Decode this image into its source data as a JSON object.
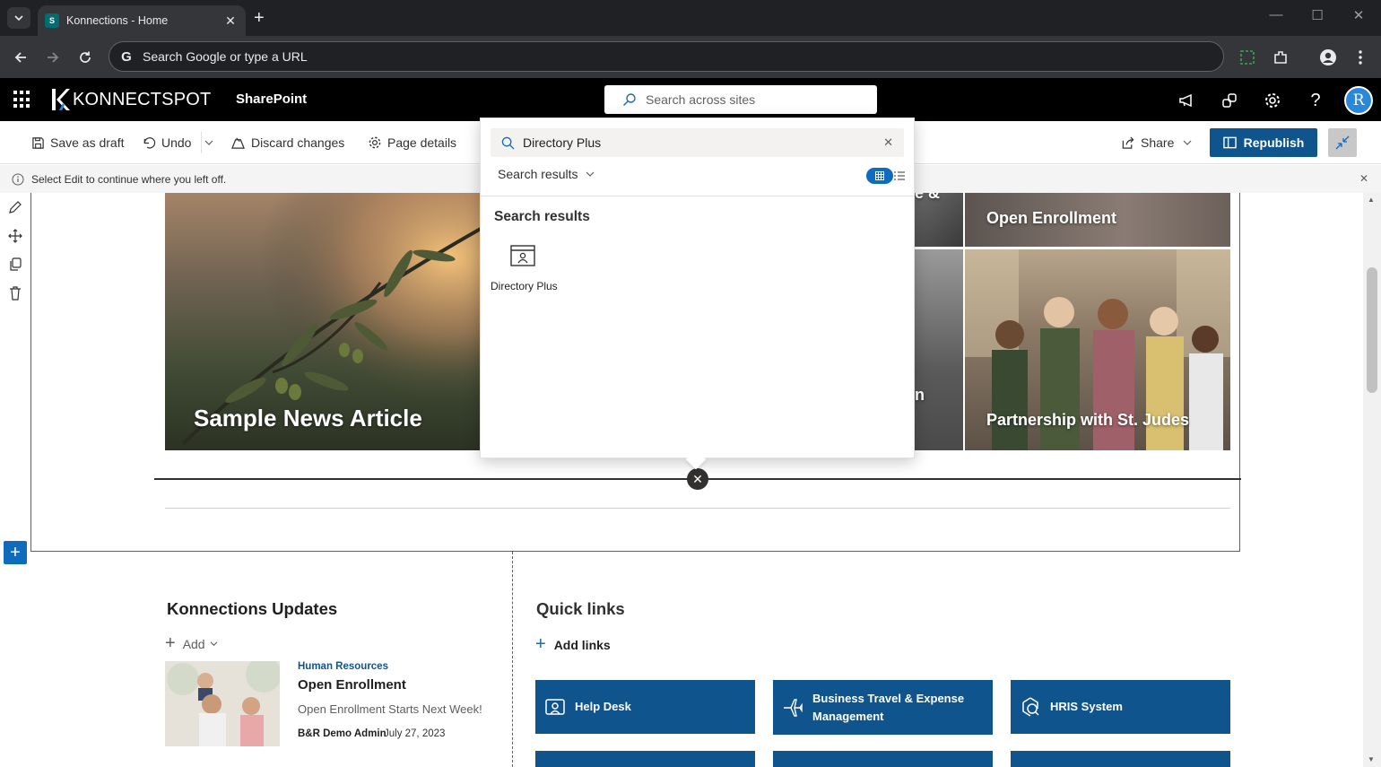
{
  "browser": {
    "tab_title": "Konnections - Home",
    "tab_favicon": "S",
    "omnibox_placeholder": "Search Google or type a URL"
  },
  "suite": {
    "brand": "KONNECTSPOT",
    "app_name": "SharePoint",
    "search_placeholder": "Search across sites",
    "avatar_initial": "R"
  },
  "commands": {
    "save_draft": "Save as draft",
    "undo": "Undo",
    "discard": "Discard changes",
    "page_details": "Page details",
    "share": "Share",
    "republish": "Republish"
  },
  "info_message": "Select Edit to continue where you left off.",
  "hero": {
    "main_title": "Sample News Article",
    "tiles": [
      {
        "title": "Open Enrollment"
      },
      {
        "title": "Partnership with St. Judes"
      }
    ],
    "partial_text_1": "e &",
    "partial_text_2": "n"
  },
  "search_popup": {
    "query": "Directory Plus",
    "filter_label": "Search results",
    "heading": "Search results",
    "results": [
      {
        "label": "Directory Plus",
        "icon": "directory-icon"
      }
    ]
  },
  "updates": {
    "heading": "Konnections Updates",
    "add_label": "Add",
    "news": {
      "category": "Human Resources",
      "title": "Open Enrollment",
      "description": "Open Enrollment Starts Next Week!",
      "author": "B&R Demo Admin",
      "date": "July 27, 2023"
    }
  },
  "quick_links": {
    "heading": "Quick links",
    "add_label": "Add links",
    "links": [
      {
        "label": "Help Desk",
        "icon": "help-desk-icon"
      },
      {
        "label": "Business Travel & Expense Management",
        "icon": "airplane-icon"
      },
      {
        "label": "HRIS System",
        "icon": "hris-icon"
      }
    ]
  },
  "colors": {
    "brand_blue": "#0f548c",
    "suite_bar": "#000000",
    "chrome_dark": "#202124"
  }
}
